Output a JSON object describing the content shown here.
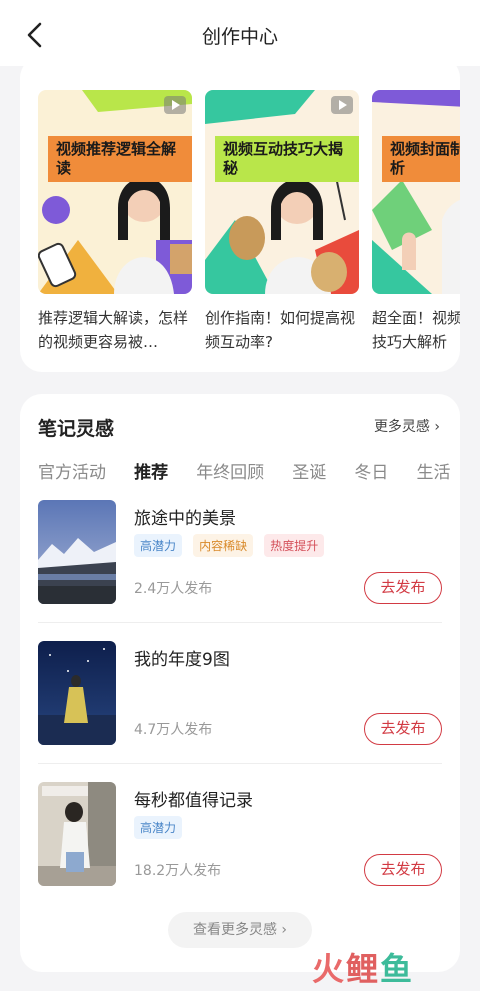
{
  "header": {
    "title": "创作中心"
  },
  "videos": [
    {
      "badge": "视频推荐逻辑全解读",
      "caption": "推荐逻辑大解读，怎样的视频更容易被…"
    },
    {
      "badge": "视频互动技巧大揭秘",
      "caption": "创作指南！如何提高视频互动率?"
    },
    {
      "badge": "视频封面制作大解析",
      "caption": "超全面！视频封面制作技巧大解析"
    }
  ],
  "inspiration": {
    "title": "笔记灵感",
    "more": "更多灵感 ›",
    "tabs": [
      "官方活动",
      "推荐",
      "年终回顾",
      "圣诞",
      "冬日",
      "生活"
    ],
    "active_tab": "推荐",
    "items": [
      {
        "name": "旅途中的美景",
        "tags": [
          "高潜力",
          "内容稀缺",
          "热度提升"
        ],
        "count": "2.4万人发布",
        "action": "去发布"
      },
      {
        "name": "我的年度9图",
        "tags": [],
        "count": "4.7万人发布",
        "action": "去发布"
      },
      {
        "name": "每秒都值得记录",
        "tags": [
          "高潜力"
        ],
        "count": "18.2万人发布",
        "action": "去发布"
      }
    ],
    "see_more": "查看更多灵感 ›"
  },
  "watermark": {
    "c1": "火",
    "c2": "鲤",
    "c3": "鱼"
  },
  "colors": {
    "accent": "#d23a43",
    "tag_blue": "#4a86c8",
    "tag_orange": "#d98a2b",
    "tag_red": "#d4505a"
  },
  "icons": {
    "back": "chevron-left-icon",
    "play": "play-icon"
  }
}
